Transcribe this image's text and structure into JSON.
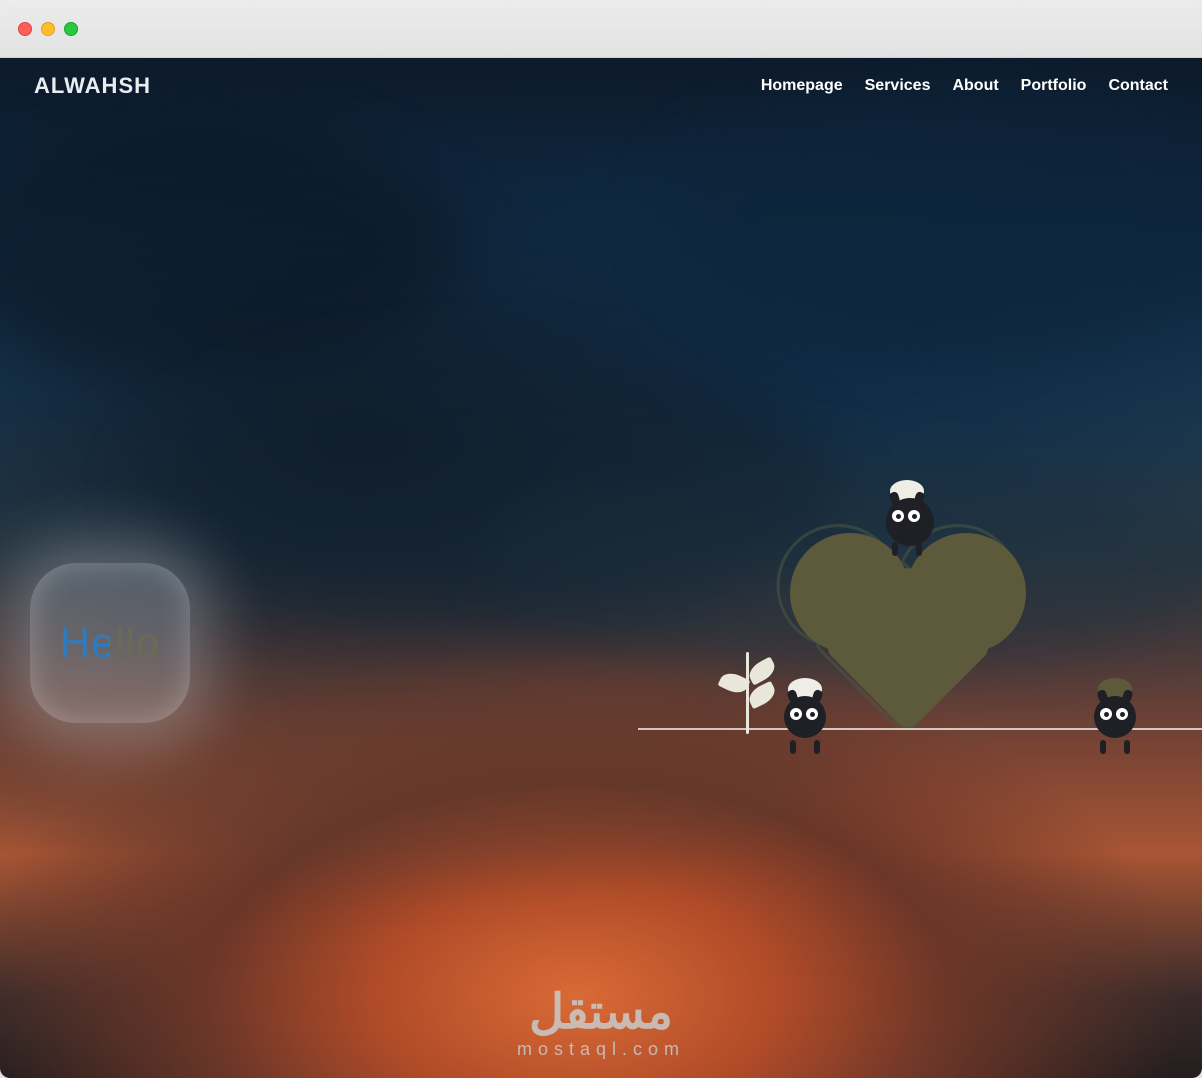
{
  "brand": "ALWAHSH",
  "nav": {
    "items": [
      {
        "label": "Homepage"
      },
      {
        "label": "Services"
      },
      {
        "label": "About"
      },
      {
        "label": "Portfolio"
      },
      {
        "label": "Contact"
      }
    ]
  },
  "hero": {
    "badge_text": "Hello"
  },
  "watermark": {
    "arabic": "مستقل",
    "latin": "mostaql.com"
  },
  "colors": {
    "heart_fill": "#5c5a3b",
    "nav_text": "#ffffff",
    "badge_bg": "rgba(200,210,220,0.30)"
  }
}
